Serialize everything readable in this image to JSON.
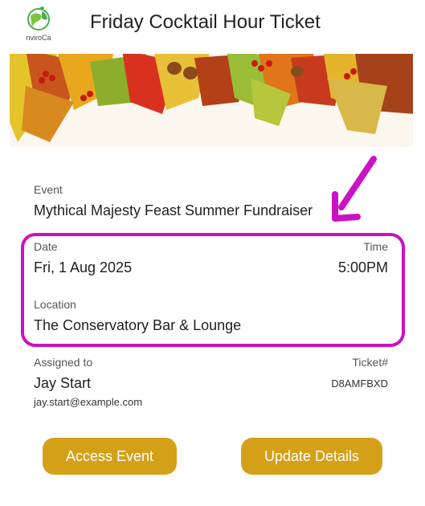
{
  "header": {
    "logo_text": "nviroCa",
    "title": "Friday Cocktail Hour Ticket"
  },
  "ticket": {
    "event_label": "Event",
    "event_value": "Mythical Majesty Feast Summer Fundraiser",
    "date_label": "Date",
    "date_value": "Fri, 1 Aug 2025",
    "time_label": "Time",
    "time_value": "5:00PM",
    "location_label": "Location",
    "location_value": "The Conservatory Bar & Lounge",
    "assigned_label": "Assigned to",
    "assigned_name": "Jay Start",
    "assigned_email": "jay.start@example.com",
    "ticket_label": "Ticket#",
    "ticket_value": "D8AMFBXD"
  },
  "actions": {
    "access_label": "Access Event",
    "update_label": "Update Details"
  },
  "colors": {
    "button": "#d4a017",
    "highlight": "#cc10c4"
  },
  "icons": {
    "logo": "globe-leaf-icon",
    "annotation": "arrow-down-left-icon"
  }
}
